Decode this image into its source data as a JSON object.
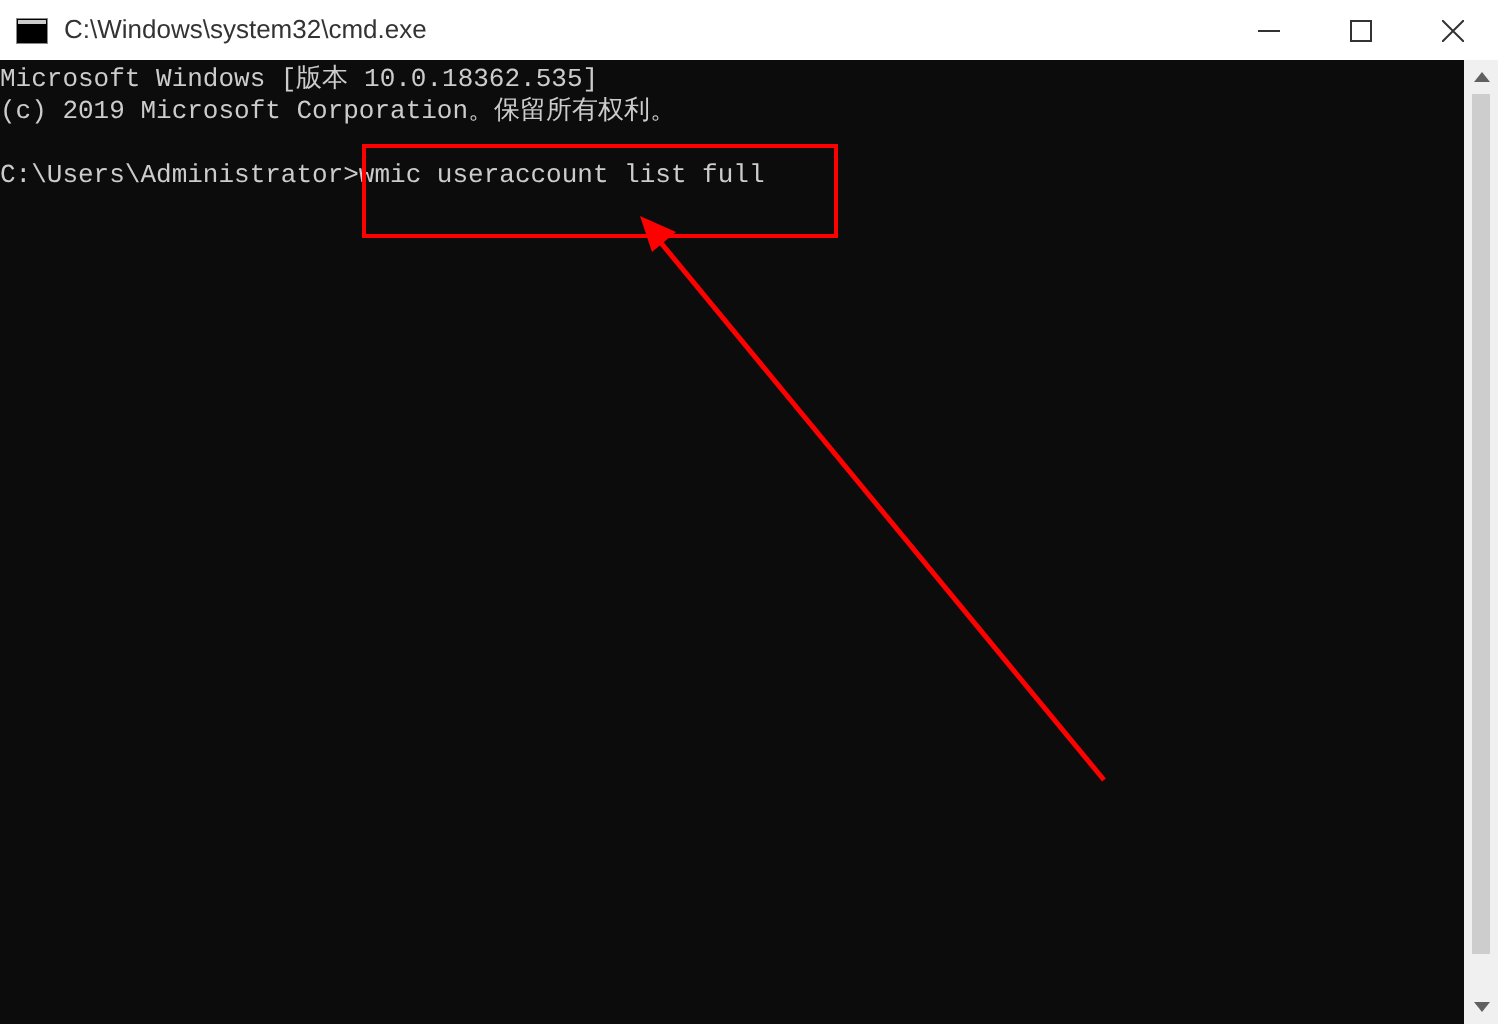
{
  "window": {
    "title": "C:\\Windows\\system32\\cmd.exe"
  },
  "console": {
    "banner": [
      "Microsoft Windows [版本 10.0.18362.535]",
      "(c) 2019 Microsoft Corporation。保留所有权利。"
    ],
    "command_line": "C:\\Users\\Administrator>wmic useraccount list full"
  }
}
